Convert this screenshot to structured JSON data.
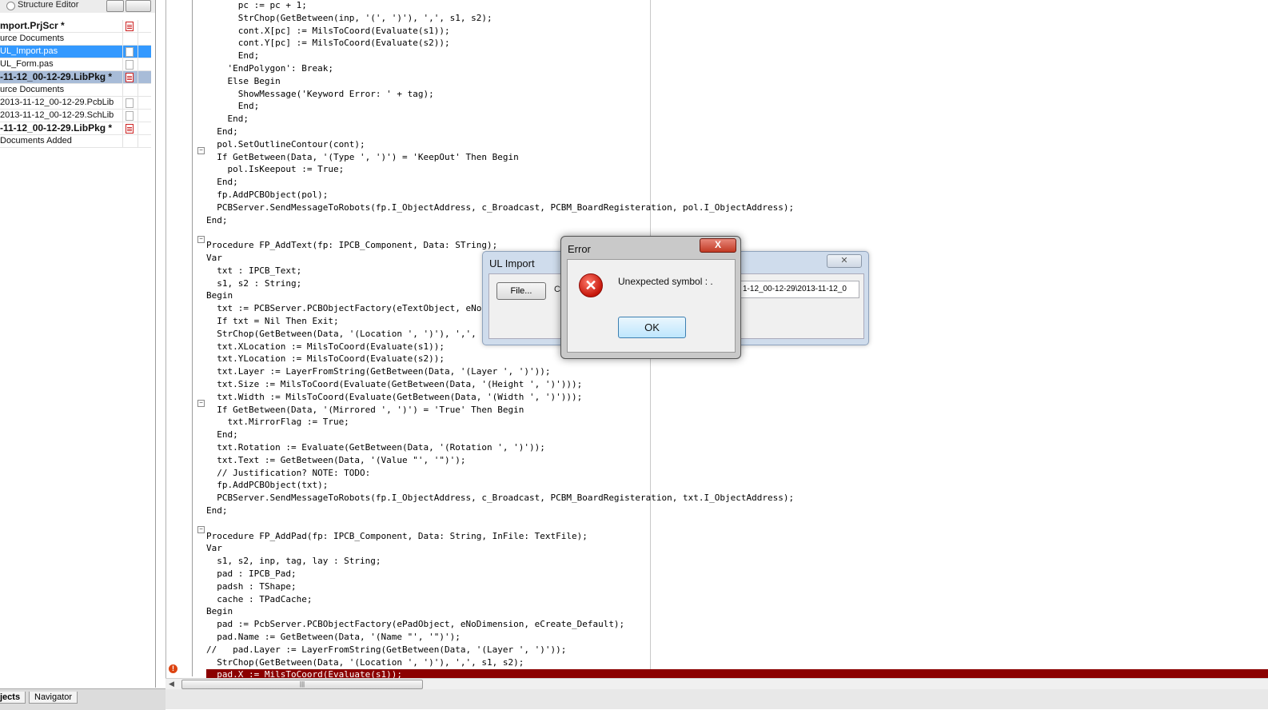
{
  "panel": {
    "structure_editor_label": "Structure Editor",
    "items": [
      {
        "label": "mport.PrjScr *",
        "style": "bold",
        "icon": "red"
      },
      {
        "label": "urce Documents",
        "style": "",
        "icon": ""
      },
      {
        "label": "UL_Import.pas",
        "style": "sel",
        "icon": "doc"
      },
      {
        "label": "UL_Form.pas",
        "style": "",
        "icon": "doc"
      },
      {
        "label": "-11-12_00-12-29.LibPkg *",
        "style": "bold hl",
        "icon": "red"
      },
      {
        "label": "urce Documents",
        "style": "",
        "icon": ""
      },
      {
        "label": "2013-11-12_00-12-29.PcbLib",
        "style": "",
        "icon": "doc"
      },
      {
        "label": "2013-11-12_00-12-29.SchLib",
        "style": "",
        "icon": "doc"
      },
      {
        "label": "-11-12_00-12-29.LibPkg *",
        "style": "bold",
        "icon": "red"
      },
      {
        "label": " Documents Added",
        "style": "",
        "icon": ""
      }
    ],
    "tabs": {
      "projects": "jects",
      "navigator": "Navigator"
    }
  },
  "code_lines": [
    "      pc := pc + 1;",
    "      StrChop(GetBetween(inp, '(', ')'), ',', s1, s2);",
    "      cont.X[pc] := MilsToCoord(Evaluate(s1));",
    "      cont.Y[pc] := MilsToCoord(Evaluate(s2));",
    "      End;",
    "    'EndPolygon': Break;",
    "    Else Begin",
    "      ShowMessage('Keyword Error: ' + tag);",
    "      End;",
    "    End;",
    "  End;",
    "  pol.SetOutlineContour(cont);",
    "  If GetBetween(Data, '(Type ', ')') = 'KeepOut' Then Begin",
    "    pol.IsKeepout := True;",
    "  End;",
    "  fp.AddPCBObject(pol);",
    "  PCBServer.SendMessageToRobots(fp.I_ObjectAddress, c_Broadcast, PCBM_BoardRegisteration, pol.I_ObjectAddress);",
    "End;",
    "",
    "Procedure FP_AddText(fp: IPCB_Component, Data: STring);",
    "Var",
    "  txt : IPCB_Text;",
    "  s1, s2 : String;",
    "Begin",
    "  txt := PCBServer.PCBObjectFactory(eTextObject, eNoDimension, eCreate_Default);",
    "  If txt = Nil Then Exit;",
    "  StrChop(GetBetween(Data, '(Location ', ')'), ',', s1, s2);",
    "  txt.XLocation := MilsToCoord(Evaluate(s1));",
    "  txt.YLocation := MilsToCoord(Evaluate(s2));",
    "  txt.Layer := LayerFromString(GetBetween(Data, '(Layer ', ')'));",
    "  txt.Size := MilsToCoord(Evaluate(GetBetween(Data, '(Height ', ')')));",
    "  txt.Width := MilsToCoord(Evaluate(GetBetween(Data, '(Width ', ')')));",
    "  If GetBetween(Data, '(Mirrored ', ')') = 'True' Then Begin",
    "    txt.MirrorFlag := True;",
    "  End;",
    "  txt.Rotation := Evaluate(GetBetween(Data, '(Rotation ', ')'));",
    "  txt.Text := GetBetween(Data, '(Value \"', '\")');",
    "  // Justification? NOTE: TODO:",
    "  fp.AddPCBObject(txt);",
    "  PCBServer.SendMessageToRobots(fp.I_ObjectAddress, c_Broadcast, PCBM_BoardRegisteration, txt.I_ObjectAddress);",
    "End;",
    "",
    "Procedure FP_AddPad(fp: IPCB_Component, Data: String, InFile: TextFile);",
    "Var",
    "  s1, s2, inp, tag, lay : String;",
    "  pad : IPCB_Pad;",
    "  padsh : TShape;",
    "  cache : TPadCache;",
    "Begin",
    "  pad := PcbServer.PCBObjectFactory(ePadObject, eNoDimension, eCreate_Default);",
    "  pad.Name := GetBetween(Data, '(Name \"', '\")');",
    "//   pad.Layer := LayerFromString(GetBetween(Data, '(Layer ', ')'));",
    "  StrChop(GetBetween(Data, '(Location ', ')'), ',', s1, s2);",
    "  pad.X := MilsToCoord(Evaluate(s1));"
  ],
  "ul_import": {
    "title": "UL Import",
    "file_button": "File...",
    "c_label": "C",
    "path_value": "1-12_00-12-29\\2013-11-12_0"
  },
  "error_dialog": {
    "title": "Error",
    "message": "Unexpected symbol : .",
    "ok_label": "OK",
    "close_glyph": "X"
  },
  "colors": {
    "error_line": "#8b0000",
    "selection": "#3399ff"
  }
}
